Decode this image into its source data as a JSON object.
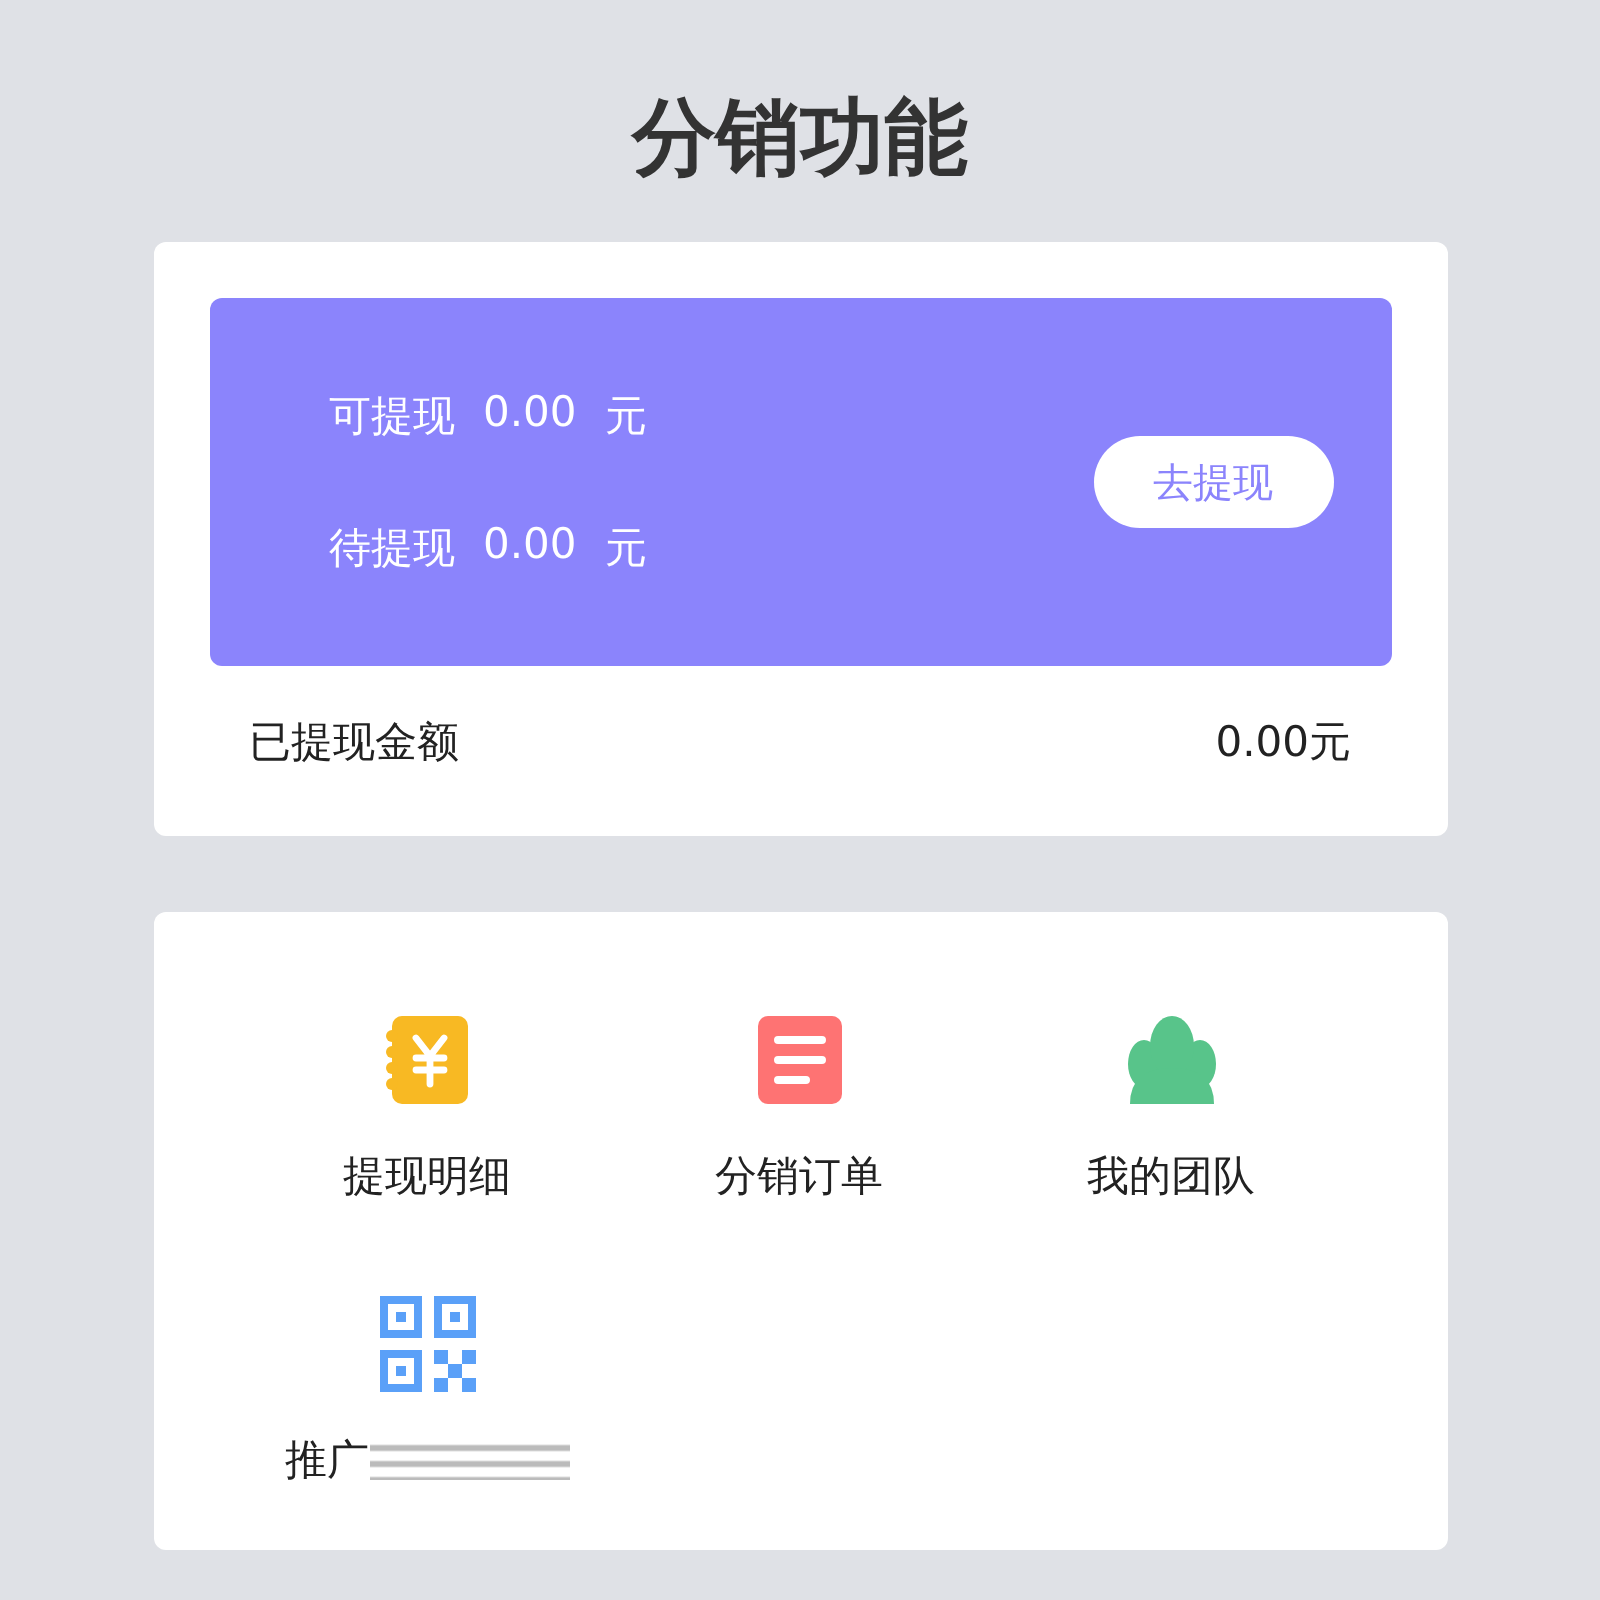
{
  "title": "分销功能",
  "balance": {
    "rows": [
      {
        "label": "可提现",
        "amount": "0.00",
        "unit": "元"
      },
      {
        "label": "待提现",
        "amount": "0.00",
        "unit": "元"
      }
    ],
    "button": "去提现"
  },
  "withdrawn": {
    "label": "已提现金额",
    "value": "0.00元"
  },
  "features": [
    {
      "label": "提现明细",
      "kind": "ledger"
    },
    {
      "label": "分销订单",
      "kind": "order"
    },
    {
      "label": "我的团队",
      "kind": "team"
    },
    {
      "label": "推广",
      "kind": "qrcode",
      "redacted": true
    }
  ]
}
